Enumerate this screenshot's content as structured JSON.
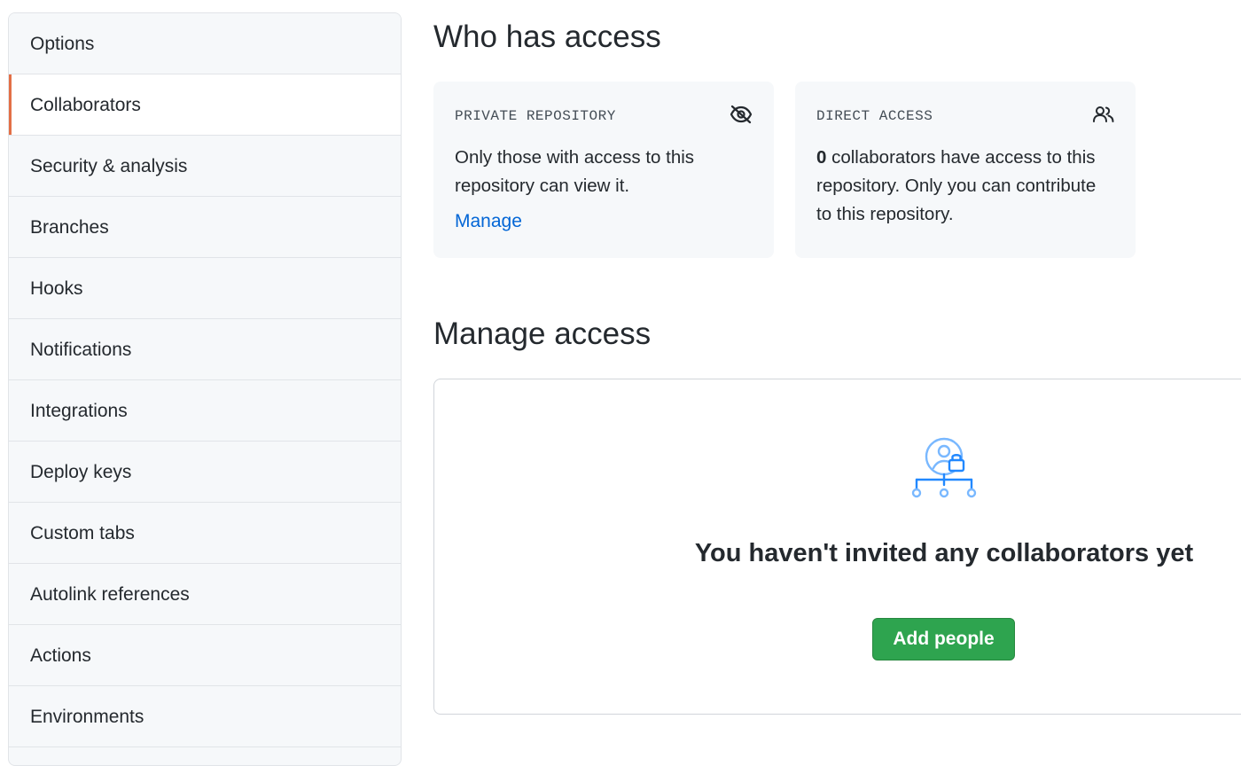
{
  "sidebar": {
    "items": [
      {
        "label": "Options"
      },
      {
        "label": "Collaborators",
        "selected": true
      },
      {
        "label": "Security & analysis"
      },
      {
        "label": "Branches"
      },
      {
        "label": "Hooks"
      },
      {
        "label": "Notifications"
      },
      {
        "label": "Integrations"
      },
      {
        "label": "Deploy keys"
      },
      {
        "label": "Custom tabs"
      },
      {
        "label": "Autolink references"
      },
      {
        "label": "Actions"
      },
      {
        "label": "Environments"
      }
    ],
    "accent_color": "#e36f46"
  },
  "who_has_access": {
    "title": "Who has access",
    "private_card": {
      "label": "PRIVATE REPOSITORY",
      "icon": "eye-closed-icon",
      "text": "Only those with access to this repository can view it.",
      "link": "Manage"
    },
    "direct_card": {
      "label": "DIRECT ACCESS",
      "icon": "people-icon",
      "count": "0",
      "text": " collaborators have access to this repository. Only you can contribute to this repository."
    }
  },
  "manage_access": {
    "title": "Manage access",
    "empty_icon": "person-lock-network-icon",
    "empty_title": "You haven't invited any collaborators yet",
    "button_label": "Add people",
    "button_color": "#2ea44f"
  }
}
